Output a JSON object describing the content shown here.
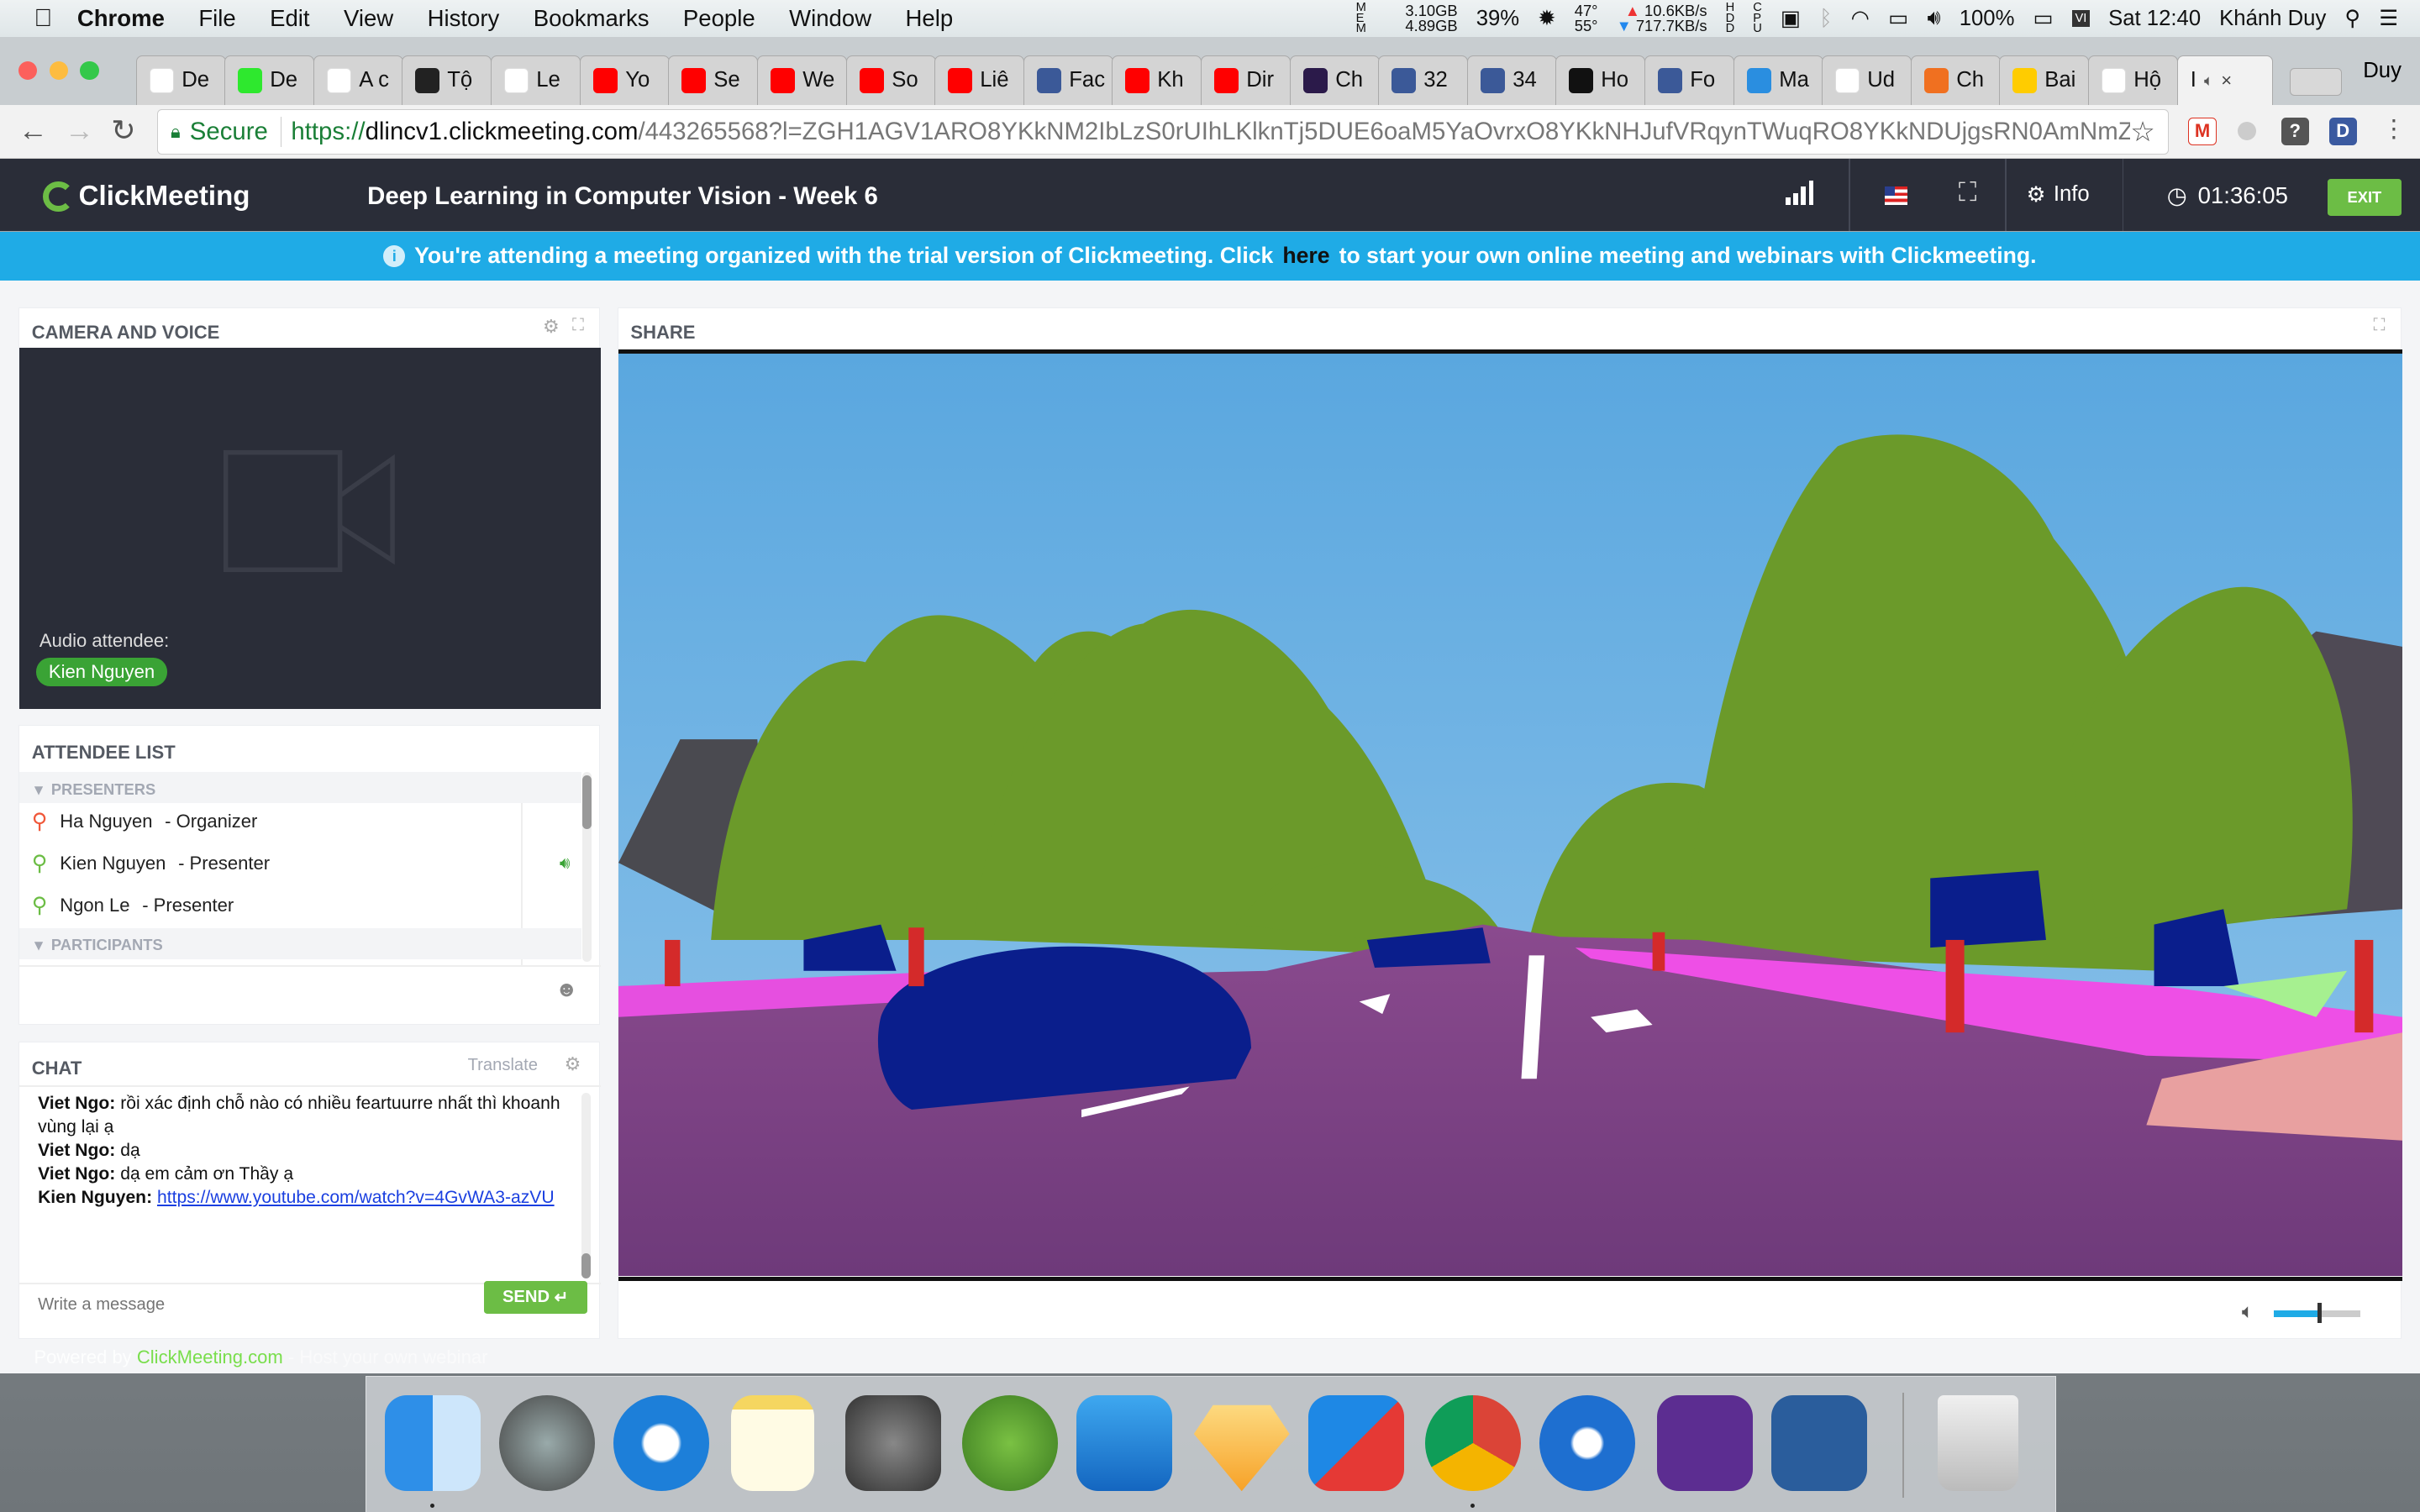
{
  "menubar": {
    "app": "Chrome",
    "items": [
      "File",
      "Edit",
      "View",
      "History",
      "Bookmarks",
      "People",
      "Window",
      "Help"
    ],
    "status": {
      "mem_used": "3.10GB",
      "mem_free": "4.89GB",
      "cpu_percent": "39%",
      "temp_cpu": "47°",
      "temp_gpu": "55°",
      "net_up": "10.6KB/s",
      "net_down": "717.7KB/s",
      "battery": "100%",
      "clock": "Sat 12:40",
      "user": "Khánh Duy"
    }
  },
  "browser": {
    "tabs": [
      {
        "label": "De",
        "color": "#ffffff",
        "icon": "chrome-dev-icon"
      },
      {
        "label": "De",
        "color": "#2ee82e",
        "icon": "smiley-icon"
      },
      {
        "label": "A c",
        "color": "#ffffff",
        "icon": "asterisk-icon"
      },
      {
        "label": "Tộ",
        "color": "#222222",
        "icon": "book-icon"
      },
      {
        "label": "Le",
        "color": "#ffffff",
        "icon": "tiki-icon"
      },
      {
        "label": "Yo",
        "color": "#ff0000",
        "icon": "youtube-icon"
      },
      {
        "label": "Se",
        "color": "#ff0000",
        "icon": "youtube-icon"
      },
      {
        "label": "We",
        "color": "#ff0000",
        "icon": "youtube-icon"
      },
      {
        "label": "So",
        "color": "#ff0000",
        "icon": "youtube-icon"
      },
      {
        "label": "Liê",
        "color": "#ff0000",
        "icon": "youtube-icon"
      },
      {
        "label": "Fac",
        "color": "#3b5998",
        "icon": "facebook-icon"
      },
      {
        "label": "Kh",
        "color": "#ff0000",
        "icon": "youtube-icon"
      },
      {
        "label": "Dir",
        "color": "#ff0000",
        "icon": "youtube-icon"
      },
      {
        "label": "Ch",
        "color": "#2b1a4a",
        "icon": "coursera-icon"
      },
      {
        "label": "32",
        "color": "#3b5998",
        "icon": "facebook-icon"
      },
      {
        "label": "34",
        "color": "#3b5998",
        "icon": "facebook-icon"
      },
      {
        "label": "Ho",
        "color": "#111111",
        "icon": "medium-icon"
      },
      {
        "label": "Fo",
        "color": "#3b5998",
        "icon": "facebook-icon"
      },
      {
        "label": "Ma",
        "color": "#2a8ee0",
        "icon": "app-icon"
      },
      {
        "label": "Ud",
        "color": "#ffffff",
        "icon": "udacity-icon"
      },
      {
        "label": "Ch",
        "color": "#f07020",
        "icon": "app-icon"
      },
      {
        "label": "Bai",
        "color": "#ffcc00",
        "icon": "b-icon"
      },
      {
        "label": "Hộ",
        "color": "#ffffff",
        "icon": "gmail-icon"
      }
    ],
    "active_tab": {
      "label": "I"
    },
    "profile": "Duy",
    "secure_label": "Secure",
    "url_scheme": "https://",
    "url_host": "dlincv1.clickmeeting.com",
    "url_path": "/443265568?l=ZGH1AGV1ARO8YKkNM2IbLzS0rUIhLKlknTj5DUE6oaM5YaOvrxO8YKkNHJufVRqynTWuqRO8YKkNDUjgsRN0AmNmZ..."
  },
  "meeting": {
    "brand": "ClickMeeting",
    "title": "Deep Learning in Computer Vision - Week 6",
    "info_label": "Info",
    "timer": "01:36:05",
    "exit_label": "EXIT",
    "banner_before": "You're attending a meeting organized with the trial version of Clickmeeting. Click",
    "banner_link": "here",
    "banner_after": "to start your own online meeting and webinars with Clickmeeting.",
    "accent": "#1fabe6",
    "green": "#6cbd45"
  },
  "camera": {
    "title": "CAMERA AND VOICE",
    "audio_label": "Audio attendee:",
    "audio_name": "Kien Nguyen"
  },
  "attendees": {
    "title": "ATTENDEE LIST",
    "presenters_label": "PRESENTERS",
    "participants_label": "PARTICIPANTS",
    "list": [
      {
        "name": "Ha Nguyen",
        "role": "- Organizer",
        "color": "#f0583a"
      },
      {
        "name": "Kien Nguyen",
        "role": "- Presenter",
        "color": "#6cbd45",
        "speaking": true
      },
      {
        "name": "Ngon Le",
        "role": "- Presenter",
        "color": "#6cbd45"
      }
    ]
  },
  "chat": {
    "title": "CHAT",
    "translate": "Translate",
    "placeholder": "Write a message",
    "send": "SEND",
    "messages": [
      {
        "author": "Viet Ngo:",
        "text": "rồi xác định chỗ nào có nhiều feartuurre nhất thì khoanh vùng lại ạ"
      },
      {
        "author": "Viet Ngo:",
        "text": "dạ"
      },
      {
        "author": "Viet Ngo:",
        "text": "dạ em cảm ơn Thầy ạ"
      },
      {
        "author": "Kien Nguyen:",
        "link": "https://www.youtube.com/watch?v=4GvWA3-azVU"
      }
    ]
  },
  "share": {
    "title": "SHARE",
    "volume": 0.5
  },
  "footer": {
    "before": "Powered by",
    "brand": "ClickMeeting.com",
    "after": "- Host your own webinar"
  }
}
